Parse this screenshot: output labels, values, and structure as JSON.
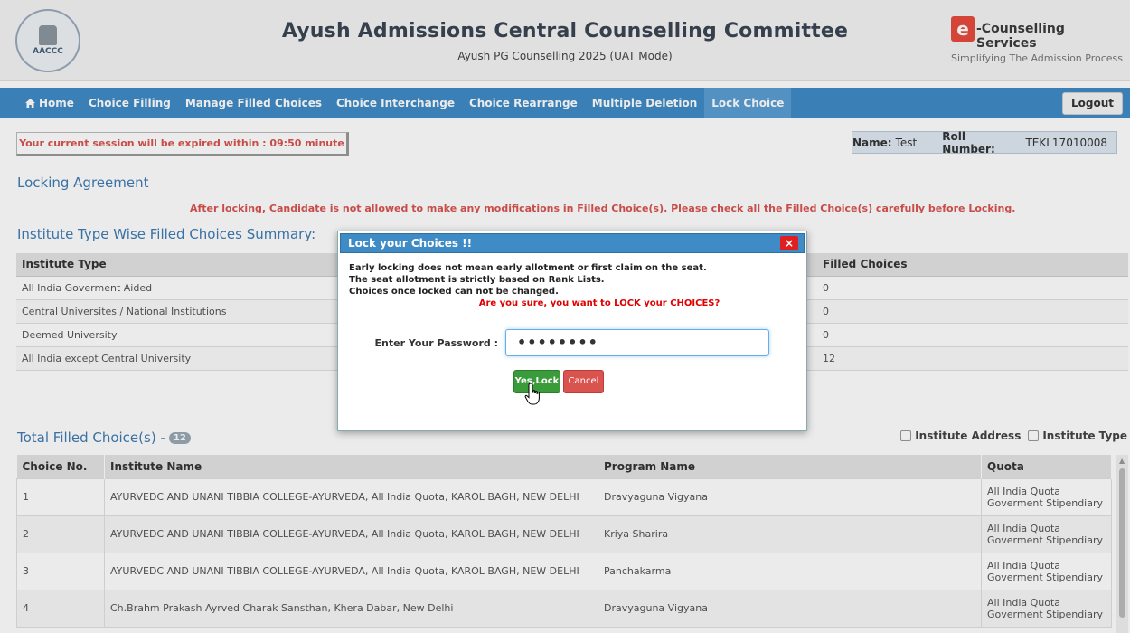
{
  "header": {
    "logo_left_text": "AACCC",
    "title": "Ayush Admissions Central Counselling Committee",
    "subtitle": "Ayush PG Counselling 2025 (UAT Mode)",
    "brand_icon_letter": "e",
    "brand_name": "-Counselling Services",
    "brand_tagline": "Simplifying The Admission Process"
  },
  "nav": {
    "items": [
      {
        "label": "Home",
        "icon": "home-icon"
      },
      {
        "label": "Choice Filling"
      },
      {
        "label": "Manage Filled Choices"
      },
      {
        "label": "Choice Interchange"
      },
      {
        "label": "Choice Rearrange"
      },
      {
        "label": "Multiple Deletion"
      },
      {
        "label": "Lock Choice",
        "active": true
      }
    ],
    "logout": "Logout"
  },
  "session": {
    "text": "Your current session will be expired within : 09:50 minute"
  },
  "user": {
    "name_label": "Name:",
    "name": "Test",
    "roll_label": "Roll Number:",
    "roll": "TEKL17010008"
  },
  "locking": {
    "title": "Locking Agreement",
    "warning": "After locking, Candidate is not allowed to make any modifications in Filled Choice(s). Please check all the Filled Choice(s) carefully before Locking."
  },
  "summary": {
    "title": "Institute Type Wise Filled Choices Summary:",
    "columns": [
      "Institute Type",
      "Filled Choices"
    ],
    "rows": [
      [
        "All India Goverment Aided",
        "0"
      ],
      [
        "Central Universites / National Institutions",
        "0"
      ],
      [
        "Deemed University",
        "0"
      ],
      [
        "All India except Central University",
        "12"
      ]
    ]
  },
  "total": {
    "title": "Total Filled Choice(s) -",
    "count": "12"
  },
  "filters": {
    "address": "Institute Address",
    "type": "Institute Type"
  },
  "choices": {
    "columns": [
      "Choice No.",
      "Institute Name",
      "Program Name",
      "Quota"
    ],
    "rows": [
      [
        "1",
        "AYURVEDC AND UNANI TIBBIA COLLEGE-AYURVEDA, All India Quota, KAROL BAGH, NEW DELHI",
        "Dravyaguna Vigyana",
        "All India Quota",
        "Goverment Stipendiary"
      ],
      [
        "2",
        "AYURVEDC AND UNANI TIBBIA COLLEGE-AYURVEDA, All India Quota, KAROL BAGH, NEW DELHI",
        "Kriya Sharira",
        "All India Quota",
        "Goverment Stipendiary"
      ],
      [
        "3",
        "AYURVEDC AND UNANI TIBBIA COLLEGE-AYURVEDA, All India Quota, KAROL BAGH, NEW DELHI",
        "Panchakarma",
        "All India Quota",
        "Goverment Stipendiary"
      ],
      [
        "4",
        "Ch.Brahm Prakash Ayrved Charak Sansthan, Khera Dabar, New Delhi",
        "Dravyaguna Vigyana",
        "All India Quota",
        "Goverment Stipendiary"
      ]
    ]
  },
  "modal": {
    "title": "Lock your Choices !!",
    "close": "×",
    "line1": "Early locking does not mean early allotment or first claim on the seat.",
    "line2": "The seat allotment is strictly based on Rank Lists.",
    "line3": "Choices once locked can not be changed.",
    "confirm": "Are you sure, you want to LOCK your CHOICES?",
    "password_label": "Enter Your Password :",
    "password_value": "••••••••",
    "yes_button": "Yes,Lock",
    "cancel_button": "Cancel"
  },
  "colors": {
    "nav": "#3f8bc6",
    "accent_red": "#d9534f",
    "yes_green": "#3a9b3a",
    "title_blue": "#3e7bb3"
  }
}
